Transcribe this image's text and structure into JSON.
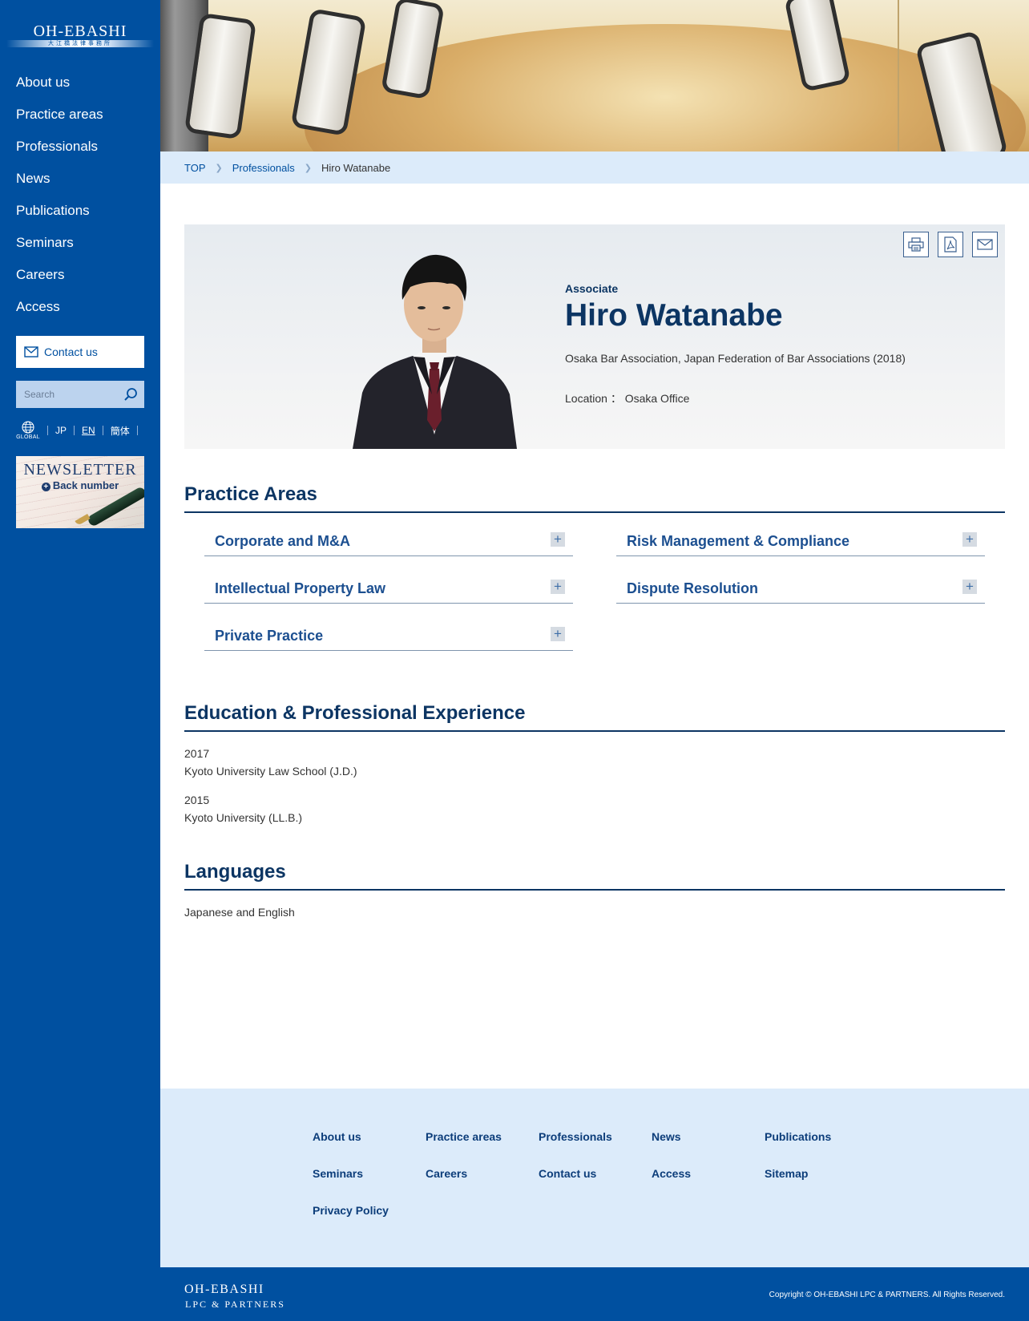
{
  "logo": {
    "main": "OH-EBASHI",
    "sub": "大江橋法律事務所"
  },
  "sidebar": {
    "nav": [
      "About us",
      "Practice areas",
      "Professionals",
      "News",
      "Publications",
      "Seminars",
      "Careers",
      "Access"
    ],
    "contact_label": "Contact us",
    "search_placeholder": "Search",
    "global_label": "GLOBAL",
    "languages": [
      "JP",
      "EN",
      "簡体"
    ],
    "active_language": "EN",
    "newsletter": {
      "title": "NEWSLETTER",
      "subtitle": "Back number"
    }
  },
  "breadcrumb": {
    "top": "TOP",
    "section": "Professionals",
    "current": "Hiro Watanabe"
  },
  "profile": {
    "role": "Associate",
    "name": "Hiro Watanabe",
    "bar": "Osaka Bar Association, Japan Federation of Bar Associations (2018)",
    "location": "Location ： Osaka Office"
  },
  "practice_areas": {
    "title": "Practice Areas",
    "items": [
      "Corporate and M&A",
      "Risk Management & Compliance",
      "Intellectual Property Law",
      "Dispute Resolution",
      "Private Practice"
    ]
  },
  "education": {
    "title": "Education & Professional Experience",
    "entries": [
      {
        "year": "2017",
        "text": "Kyoto University Law School (J.D.)"
      },
      {
        "year": "2015",
        "text": "Kyoto University (LL.B.)"
      }
    ]
  },
  "languages_section": {
    "title": "Languages",
    "text": "Japanese and English"
  },
  "footer": {
    "links": [
      "About us",
      "Practice areas",
      "Professionals",
      "News",
      "Publications",
      "Seminars",
      "Careers",
      "Contact us",
      "Access",
      "Sitemap",
      "Privacy Policy"
    ],
    "logo_main": "OH-EBASHI",
    "logo_sub": "LPC & PARTNERS",
    "copyright": "Copyright © OH-EBASHI LPC & PARTNERS. All Rights Reserved."
  },
  "colors": {
    "sidebar": "#0050a0",
    "heading": "#0c3563",
    "link": "#1c4f90",
    "light_bg": "#dcebfa"
  }
}
